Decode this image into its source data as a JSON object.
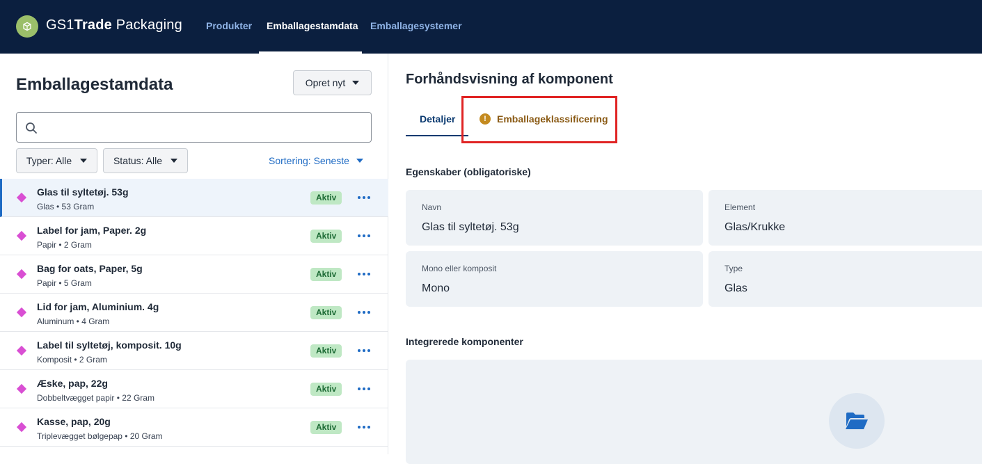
{
  "app": {
    "logo_regular_1": "GS1",
    "logo_bold": "Trade",
    "logo_regular_2": " Packaging"
  },
  "nav": [
    {
      "label": "Produkter",
      "active": false
    },
    {
      "label": "Emballagestamdata",
      "active": true
    },
    {
      "label": "Emballagesystemer",
      "active": false
    }
  ],
  "left": {
    "title": "Emballagestamdata",
    "new_button": "Opret nyt",
    "search_value": "",
    "filters": {
      "type": "Typer: Alle",
      "status": "Status: Alle"
    },
    "sort": "Sortering: Seneste",
    "items": [
      {
        "title": "Glas til syltetøj. 53g",
        "subtitle": "Glas • 53 Gram",
        "status": "Aktiv"
      },
      {
        "title": "Label for jam, Paper. 2g",
        "subtitle": "Papir • 2 Gram",
        "status": "Aktiv"
      },
      {
        "title": "Bag for oats, Paper, 5g",
        "subtitle": "Papir • 5 Gram",
        "status": "Aktiv"
      },
      {
        "title": "Lid for jam, Aluminium. 4g",
        "subtitle": "Aluminum • 4 Gram",
        "status": "Aktiv"
      },
      {
        "title": "Label til syltetøj, komposit. 10g",
        "subtitle": "Komposit • 2 Gram",
        "status": "Aktiv"
      },
      {
        "title": "Æske, pap, 22g",
        "subtitle": "Dobbeltvægget papir • 22 Gram",
        "status": "Aktiv"
      },
      {
        "title": "Kasse, pap, 20g",
        "subtitle": "Triplevægget bølgepap • 20 Gram",
        "status": "Aktiv"
      }
    ]
  },
  "right": {
    "title": "Forhåndsvisning af komponent",
    "tabs": {
      "details": "Detaljer",
      "classification": "Emballageklassificering",
      "classification_warning_glyph": "!"
    },
    "properties_label": "Egenskaber (obligatoriske)",
    "properties": {
      "name_label": "Navn",
      "name_value": "Glas til syltetøj. 53g",
      "element_label": "Element",
      "element_value": "Glas/Krukke",
      "mono_label": "Mono eller komposit",
      "mono_value": "Mono",
      "type_label": "Type",
      "type_value": "Glas"
    },
    "integrated_label": "Integrerede komponenter"
  },
  "colors": {
    "topbar": "#0b1f3f",
    "accent_blue": "#1f6bc4",
    "status_active_bg": "#bfe8c4",
    "highlight_red": "#e02424",
    "diamond_pink": "#d94fd3"
  }
}
